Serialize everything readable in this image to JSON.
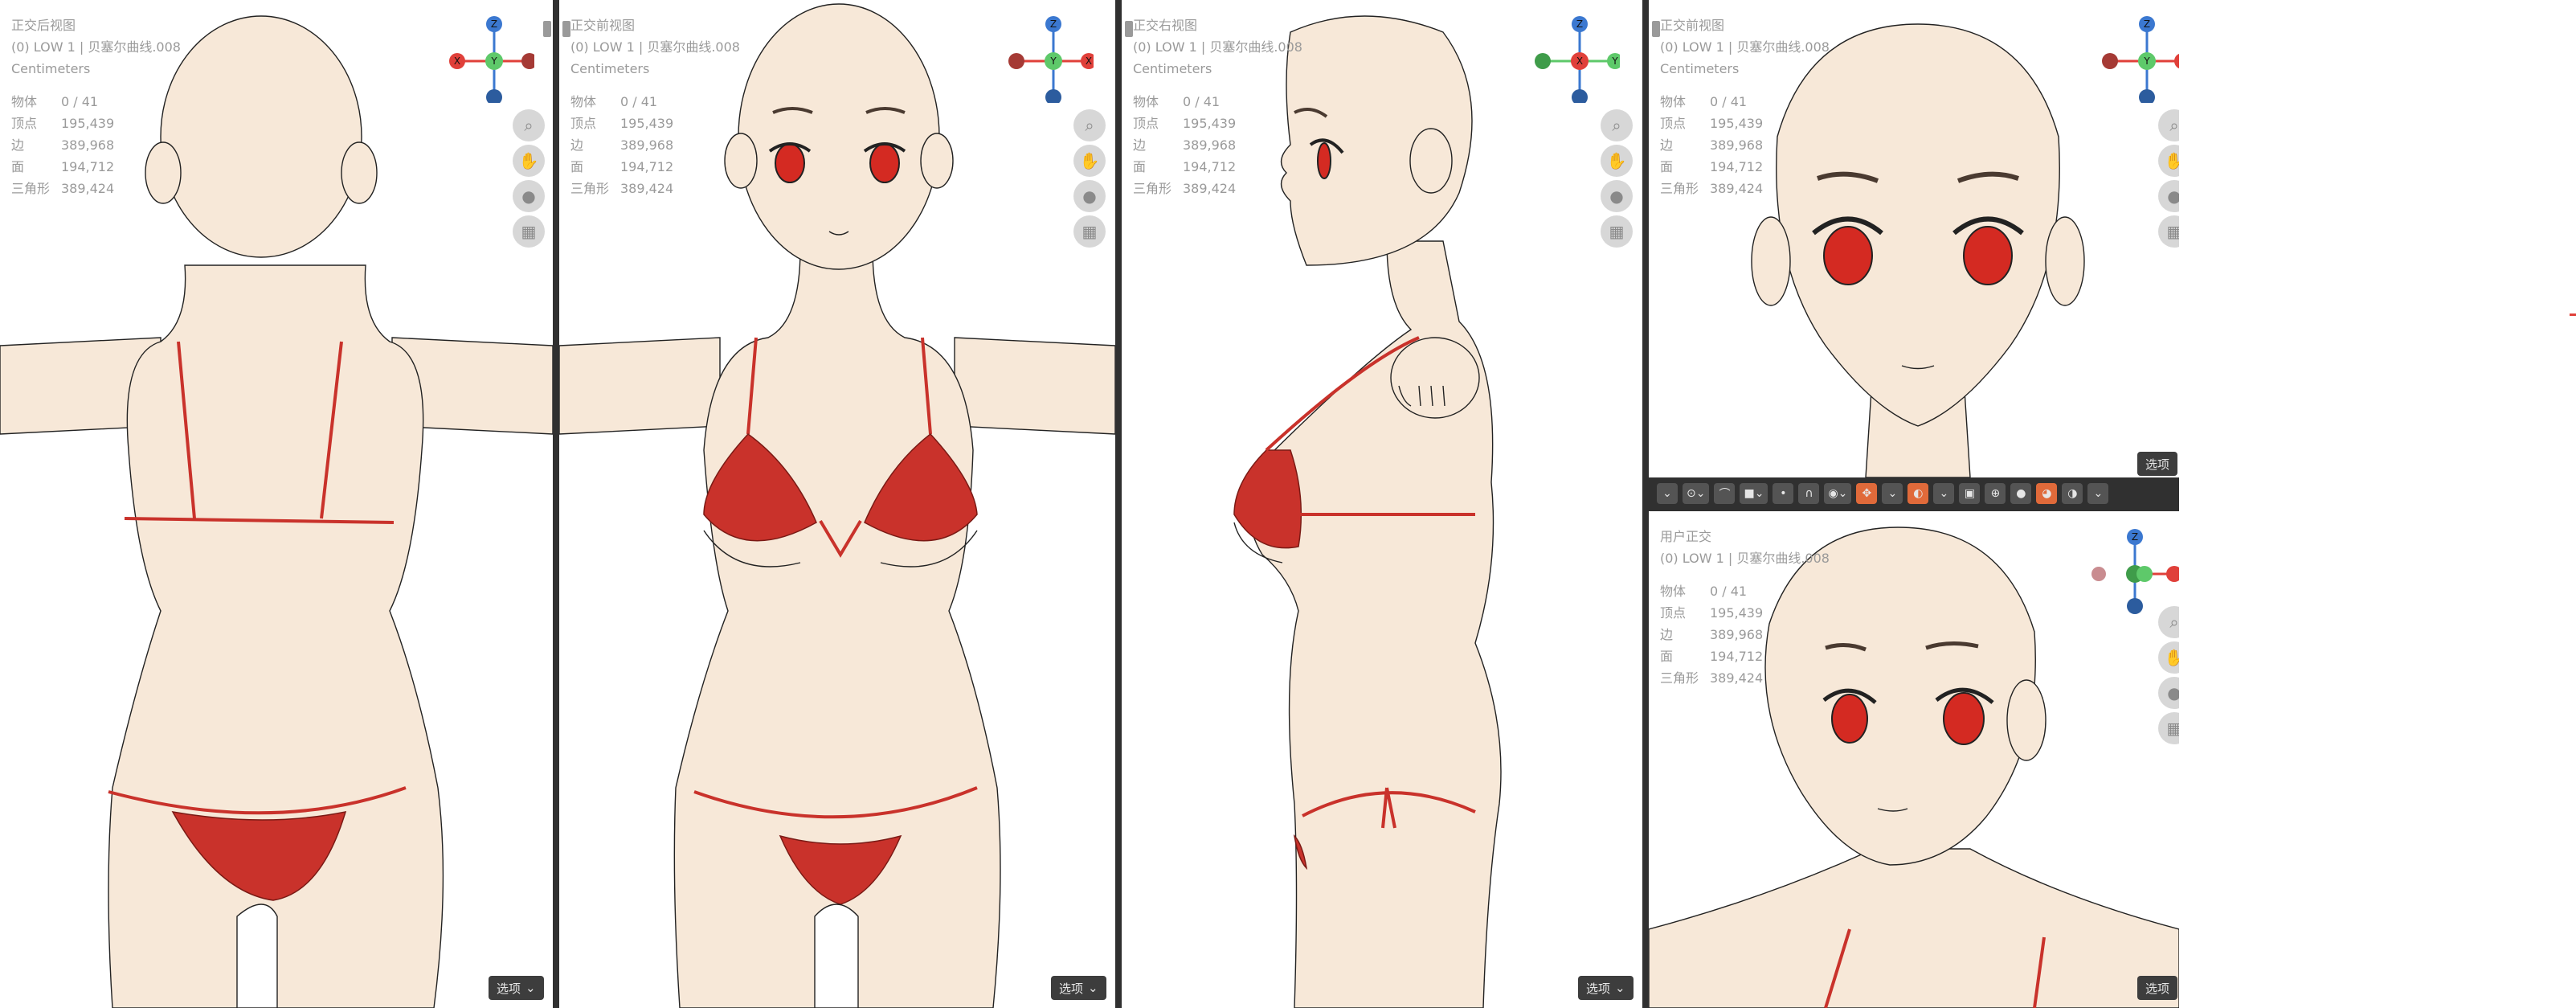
{
  "viewports": [
    {
      "view_name": "正交后视图",
      "object": "(0) LOW 1 | 贝塞尔曲线.008",
      "units": "Centimeters",
      "stats": [
        {
          "k": "物体",
          "v": "0 / 41"
        },
        {
          "k": "顶点",
          "v": "195,439"
        },
        {
          "k": "边",
          "v": "389,968"
        },
        {
          "k": "面",
          "v": "194,712"
        },
        {
          "k": "三角形",
          "v": "389,424"
        }
      ],
      "gizmo": {
        "top": "Z",
        "left": "X",
        "center": "Y",
        "right": "",
        "bottom": ""
      },
      "options_label": "选项"
    },
    {
      "view_name": "正交前视图",
      "object": "(0) LOW 1 | 贝塞尔曲线.008",
      "units": "Centimeters",
      "stats": [
        {
          "k": "物体",
          "v": "0 / 41"
        },
        {
          "k": "顶点",
          "v": "195,439"
        },
        {
          "k": "边",
          "v": "389,968"
        },
        {
          "k": "面",
          "v": "194,712"
        },
        {
          "k": "三角形",
          "v": "389,424"
        }
      ],
      "gizmo": {
        "top": "Z",
        "left": "",
        "center": "Y",
        "right": "X",
        "bottom": ""
      },
      "options_label": "选项"
    },
    {
      "view_name": "正交右视图",
      "object": "(0) LOW 1 | 贝塞尔曲线.008",
      "units": "Centimeters",
      "stats": [
        {
          "k": "物体",
          "v": "0 / 41"
        },
        {
          "k": "顶点",
          "v": "195,439"
        },
        {
          "k": "边",
          "v": "389,968"
        },
        {
          "k": "面",
          "v": "194,712"
        },
        {
          "k": "三角形",
          "v": "389,424"
        }
      ],
      "gizmo": {
        "top": "Z",
        "left": "",
        "center": "X",
        "right": "Y",
        "bottom": ""
      },
      "options_label": "选项"
    },
    {
      "view_name": "正交前视图",
      "object": "(0) LOW 1 | 贝塞尔曲线.008",
      "units": "Centimeters",
      "stats": [
        {
          "k": "物体",
          "v": "0 / 41"
        },
        {
          "k": "顶点",
          "v": "195,439"
        },
        {
          "k": "边",
          "v": "389,968"
        },
        {
          "k": "面",
          "v": "194,712"
        },
        {
          "k": "三角形",
          "v": "389,424"
        }
      ],
      "gizmo": {
        "top": "Z",
        "left": "",
        "center": "Y",
        "right": "",
        "bottom": ""
      },
      "options_label": "选项"
    },
    {
      "view_name": "用户正交",
      "object": "(0) LOW 1 | 贝塞尔曲线.008",
      "units": "",
      "stats": [
        {
          "k": "物体",
          "v": "0 / 41"
        },
        {
          "k": "顶点",
          "v": "195,439"
        },
        {
          "k": "边",
          "v": "389,968"
        },
        {
          "k": "面",
          "v": "194,712"
        },
        {
          "k": "三角形",
          "v": "389,424"
        }
      ],
      "gizmo": {
        "top": "Z",
        "left": "",
        "center": "",
        "right": "",
        "bottom": ""
      },
      "options_label": "选项"
    }
  ],
  "colors": {
    "skin": "#f7e8d8",
    "bikini": "#c9322b",
    "eye": "#d42a22",
    "axis_x": "#e0403a",
    "axis_y": "#5ec96a",
    "axis_z": "#3b78d0"
  },
  "toolbar_icons": [
    "view-icon",
    "snap-icon",
    "proportional-icon",
    "overlay-icon",
    "gizmo-icon",
    "xray-icon",
    "shading-wire-icon",
    "shading-solid-icon",
    "shading-material-icon",
    "shading-render-icon"
  ]
}
